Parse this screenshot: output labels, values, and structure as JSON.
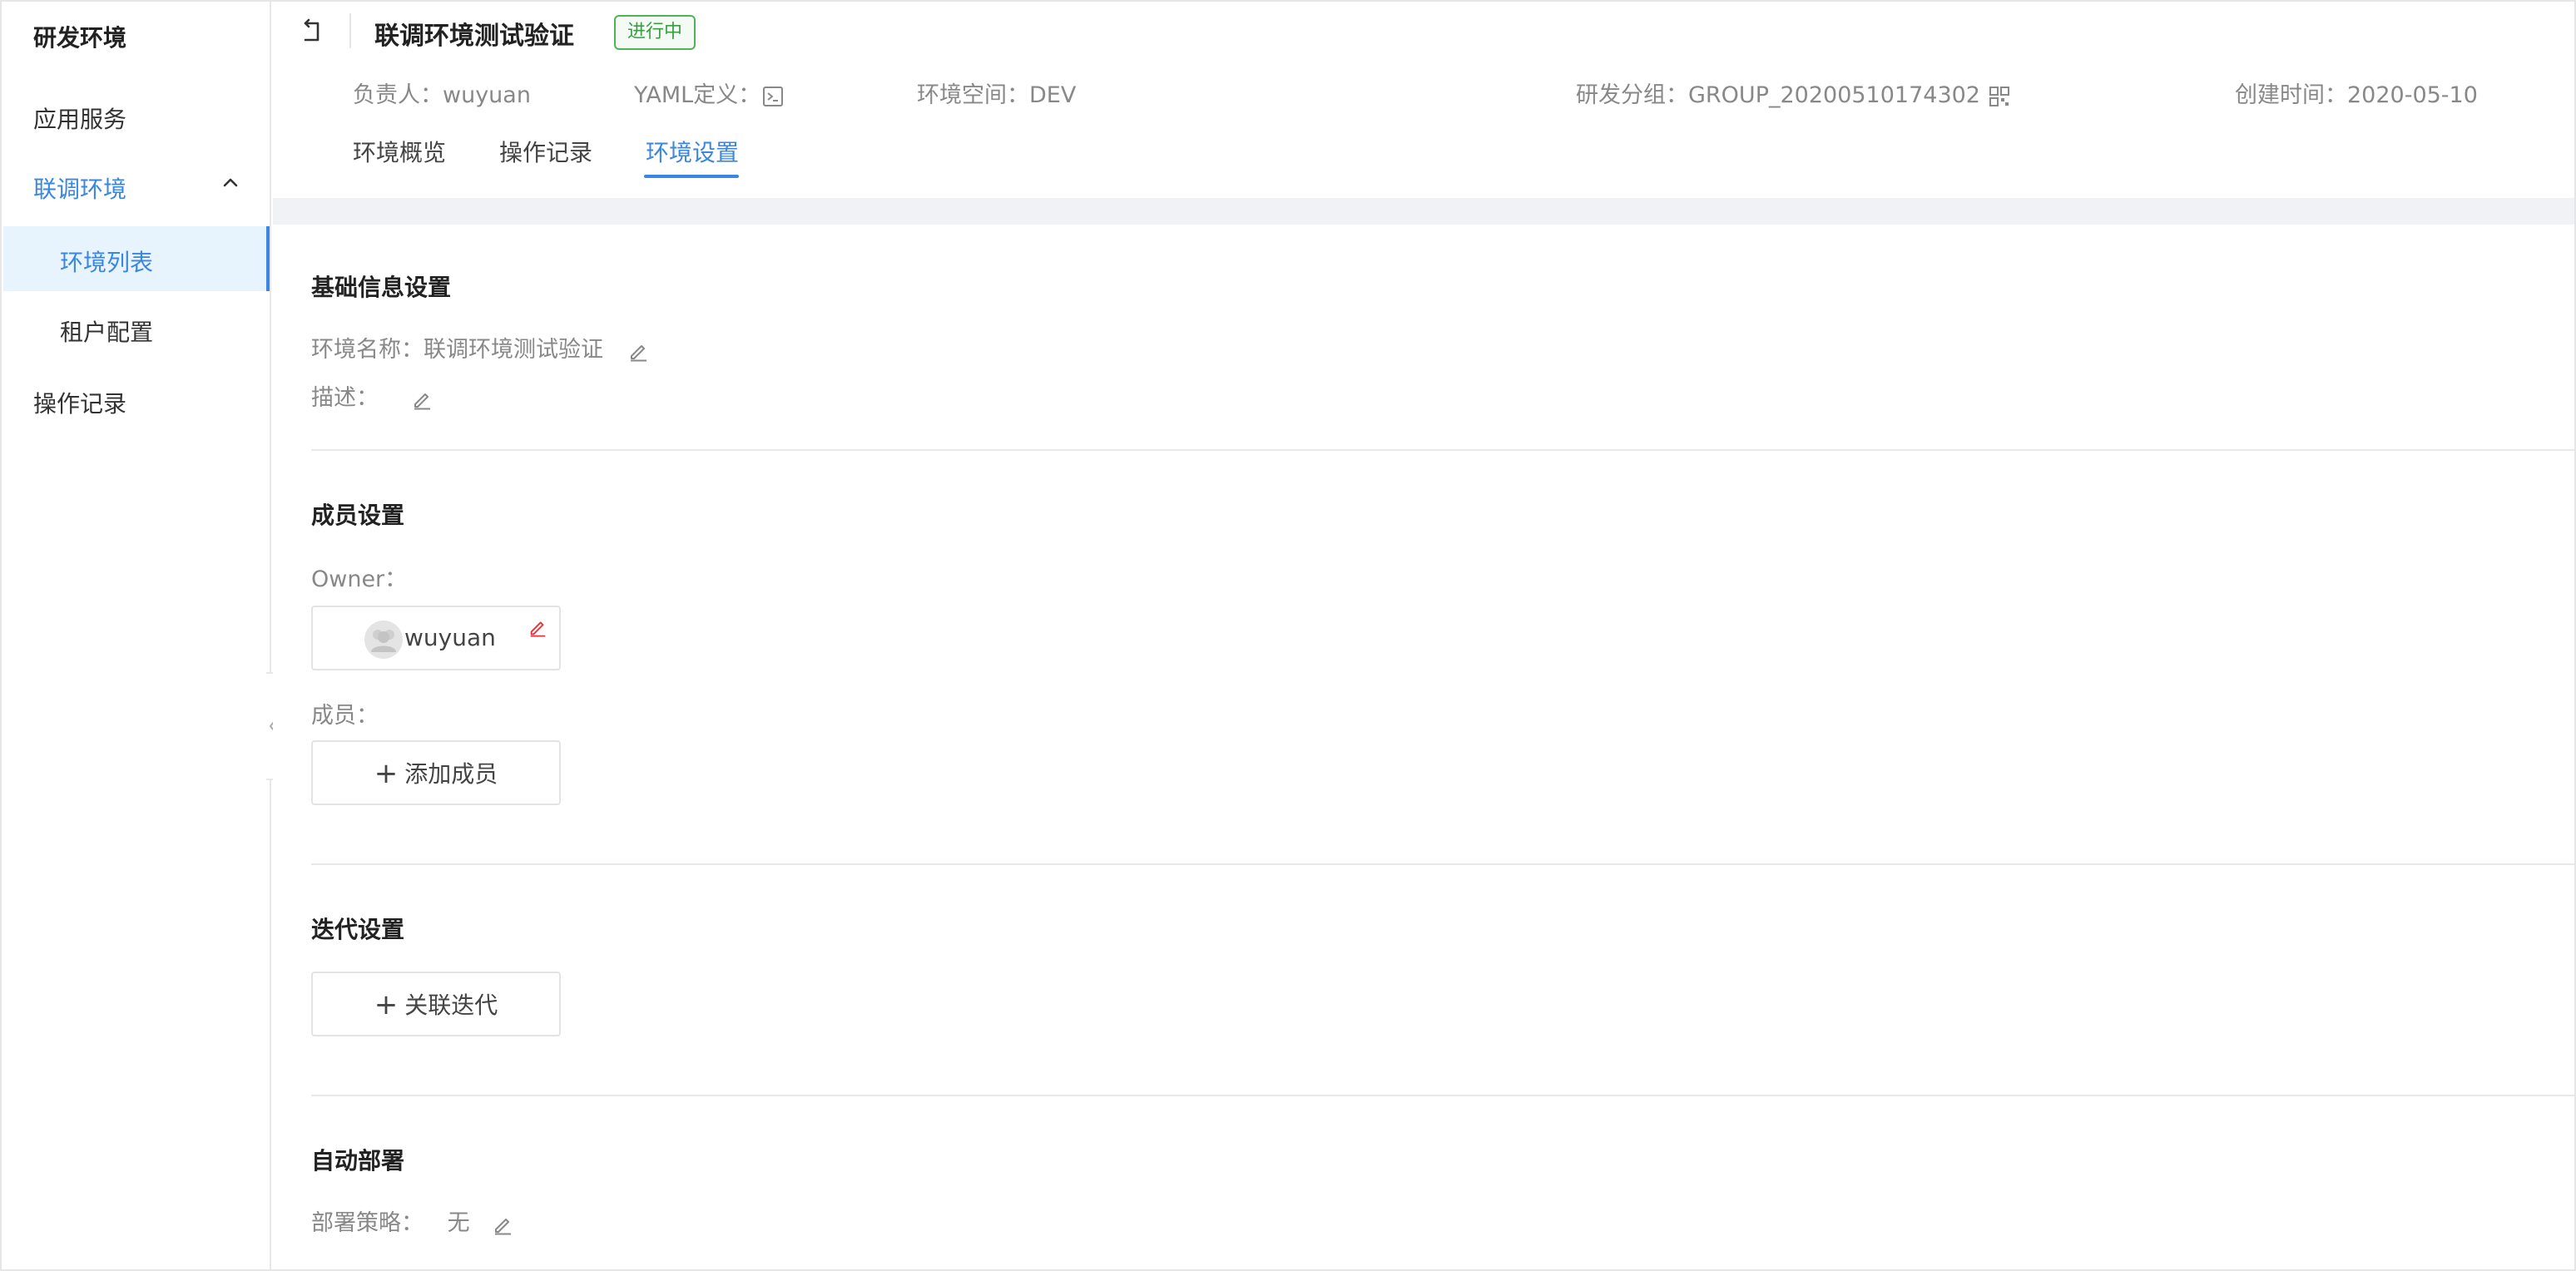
{
  "sidebar": {
    "title": "研发环境",
    "items": [
      {
        "label": "应用服务"
      },
      {
        "label": "联调环境"
      },
      {
        "label": "操作记录"
      }
    ],
    "subitems": [
      {
        "label": "环境列表"
      },
      {
        "label": "租户配置"
      }
    ]
  },
  "header": {
    "title": "联调环境测试验证",
    "status": "进行中",
    "meta": {
      "owner_label": "负责人：",
      "owner_value": "wuyuan",
      "yaml_label": "YAML定义：",
      "space_label": "环境空间：",
      "space_value": "DEV",
      "group_label": "研发分组：",
      "group_value": "GROUP_20200510174302",
      "created_label": "创建时间：",
      "created_value": "2020-05-10"
    },
    "tabs": [
      {
        "label": "环境概览"
      },
      {
        "label": "操作记录"
      },
      {
        "label": "环境设置"
      }
    ]
  },
  "basic": {
    "title": "基础信息设置",
    "name_label": "环境名称：",
    "name_value": "联调环境测试验证",
    "desc_label": "描述："
  },
  "members": {
    "title": "成员设置",
    "owner_label": "Owner：",
    "owner_name": "wuyuan",
    "members_label": "成员：",
    "add_member": "添加成员"
  },
  "iteration": {
    "title": "迭代设置",
    "link_iteration": "关联迭代"
  },
  "deploy": {
    "title": "自动部署",
    "strategy_label": "部署策略：",
    "strategy_value": "无"
  },
  "colors": {
    "accent": "#3a86e0",
    "status_green": "#52b25a",
    "muted_text": "#888888",
    "owner_edit_red": "#d9363e"
  }
}
